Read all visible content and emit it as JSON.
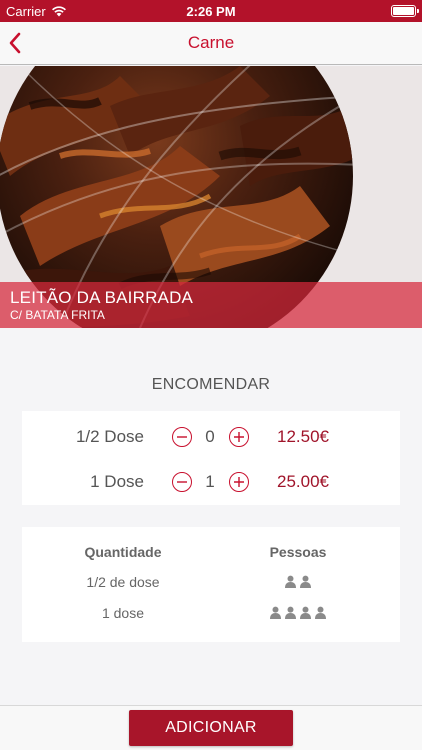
{
  "status_bar": {
    "carrier": "Carrier",
    "time": "2:26 PM"
  },
  "nav": {
    "title": "Carne",
    "back_icon": "chevron-left-icon"
  },
  "hero": {
    "title": "LEITÃO DA BAIRRADA",
    "subtitle": "C/ BATATA FRITA"
  },
  "order": {
    "title": "ENCOMENDAR",
    "items": [
      {
        "label": "1/2 Dose",
        "quantity": "0",
        "price": "12.50€"
      },
      {
        "label": "1 Dose",
        "quantity": "1",
        "price": "25.00€"
      }
    ]
  },
  "info": {
    "headers": {
      "quantity": "Quantidade",
      "people": "Pessoas"
    },
    "rows": [
      {
        "quantity": "1/2 de dose",
        "people_count": 2
      },
      {
        "quantity": "1 dose",
        "people_count": 4
      }
    ]
  },
  "bottom": {
    "add_label": "ADICIONAR"
  },
  "colors": {
    "brand": "#c8102e",
    "button": "#a8152a",
    "price": "#a0142a"
  }
}
